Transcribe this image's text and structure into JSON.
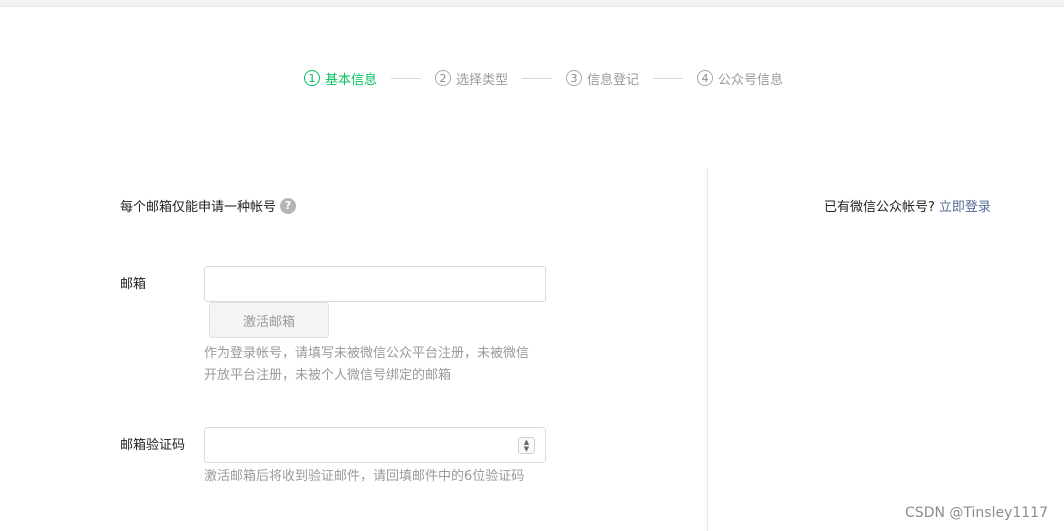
{
  "stepper": {
    "steps": [
      {
        "number": "1",
        "label": "基本信息",
        "active": true
      },
      {
        "number": "2",
        "label": "选择类型",
        "active": false
      },
      {
        "number": "3",
        "label": "信息登记",
        "active": false
      },
      {
        "number": "4",
        "label": "公众号信息",
        "active": false
      }
    ]
  },
  "form": {
    "notice": "每个邮箱仅能申请一种帐号",
    "help_symbol": "?",
    "email": {
      "label": "邮箱",
      "value": "",
      "activate_button": "激活邮箱",
      "tip": "作为登录帐号，请填写未被微信公众平台注册，未被微信开放平台注册，未被个人微信号绑定的邮箱"
    },
    "code": {
      "label": "邮箱验证码",
      "value": "",
      "tip": "激活邮箱后将收到验证邮件，请回填邮件中的6位验证码"
    }
  },
  "login": {
    "prompt": "已有微信公众帐号?",
    "link": "立即登录"
  },
  "watermark": "CSDN @Tinsley1117",
  "colors": {
    "accent_green": "#07c160",
    "link_blue": "#576b95",
    "muted_text": "#9a9a9a"
  }
}
